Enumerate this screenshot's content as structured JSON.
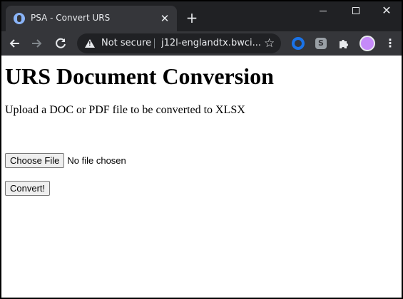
{
  "browser": {
    "tab_title": "PSA - Convert URS",
    "tab_close": "✕",
    "new_tab": "+",
    "window_close": "✕",
    "security_label": "Not secure",
    "url": "j12l-englandtx.bwci...",
    "extension_s": "S",
    "icons": [
      "favicon-icon",
      "close-icon",
      "plus-icon",
      "minimize-icon",
      "maximize-icon",
      "back-icon",
      "forward-icon",
      "reload-icon",
      "warning-icon",
      "star-icon",
      "extension-ring-icon",
      "extension-s-icon",
      "puzzle-icon",
      "avatar",
      "menu-icon"
    ]
  },
  "page": {
    "heading": "URS Document Conversion",
    "description": "Upload a DOC or PDF file to be converted to XLSX",
    "choose_file_label": "Choose File",
    "file_status": "No file chosen",
    "convert_label": "Convert!"
  }
}
